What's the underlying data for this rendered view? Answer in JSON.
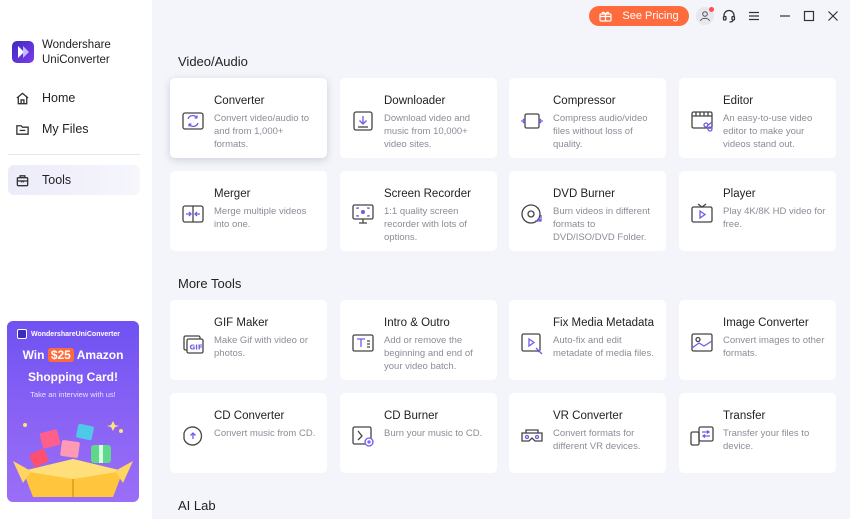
{
  "app": {
    "name_line1": "Wondershare",
    "name_line2": "UniConverter"
  },
  "nav": [
    {
      "label": "Home",
      "icon": "home-icon"
    },
    {
      "label": "My Files",
      "icon": "folder-icon"
    },
    {
      "label": "Tools",
      "icon": "toolbox-icon",
      "active": true
    }
  ],
  "promo": {
    "brand": "WondershareUniConverter",
    "win": "Win",
    "amount": "$25",
    "amazon": "Amazon",
    "line2": "Shopping Card!",
    "line3": "Take an interview with us!"
  },
  "topbar": {
    "pricing": "See Pricing"
  },
  "sections": [
    {
      "title": "Video/Audio",
      "cards": [
        {
          "title": "Converter",
          "desc": "Convert video/audio to and from 1,000+ formats.",
          "icon": "converter-icon"
        },
        {
          "title": "Downloader",
          "desc": "Download video and music from 10,000+ video sites.",
          "icon": "download-icon"
        },
        {
          "title": "Compressor",
          "desc": "Compress audio/video files without loss of quality.",
          "icon": "compress-icon"
        },
        {
          "title": "Editor",
          "desc": "An easy-to-use video editor to make your videos stand out.",
          "icon": "editor-icon"
        },
        {
          "title": "Merger",
          "desc": "Merge multiple videos into one.",
          "icon": "merge-icon"
        },
        {
          "title": "Screen Recorder",
          "desc": "1:1 quality screen recorder with lots of options.",
          "icon": "screen-record-icon"
        },
        {
          "title": "DVD Burner",
          "desc": "Burn videos in different formats to DVD/ISO/DVD Folder.",
          "icon": "dvd-icon"
        },
        {
          "title": "Player",
          "desc": "Play 4K/8K HD video for free.",
          "icon": "player-icon"
        }
      ]
    },
    {
      "title": "More Tools",
      "cards": [
        {
          "title": "GIF Maker",
          "desc": "Make Gif with video or photos.",
          "icon": "gif-icon"
        },
        {
          "title": "Intro & Outro",
          "desc": "Add or remove the beginning and end of your video batch.",
          "icon": "intro-outro-icon"
        },
        {
          "title": "Fix Media Metadata",
          "desc": "Auto-fix and edit metadate of media files.",
          "icon": "metadata-icon"
        },
        {
          "title": "Image Converter",
          "desc": "Convert images to other formats.",
          "icon": "image-icon"
        },
        {
          "title": "CD Converter",
          "desc": "Convert music from CD.",
          "icon": "cd-icon"
        },
        {
          "title": "CD Burner",
          "desc": "Burn your music to CD.",
          "icon": "cd-burner-icon"
        },
        {
          "title": "VR Converter",
          "desc": "Convert formats for different VR devices.",
          "icon": "vr-icon"
        },
        {
          "title": "Transfer",
          "desc": "Transfer your files to device.",
          "icon": "transfer-icon"
        }
      ]
    },
    {
      "title": "AI Lab",
      "cards": []
    }
  ],
  "colors": {
    "accent": "#6c5ce7",
    "pricing": "#ff6b3d",
    "background": "#f3f5fa"
  }
}
